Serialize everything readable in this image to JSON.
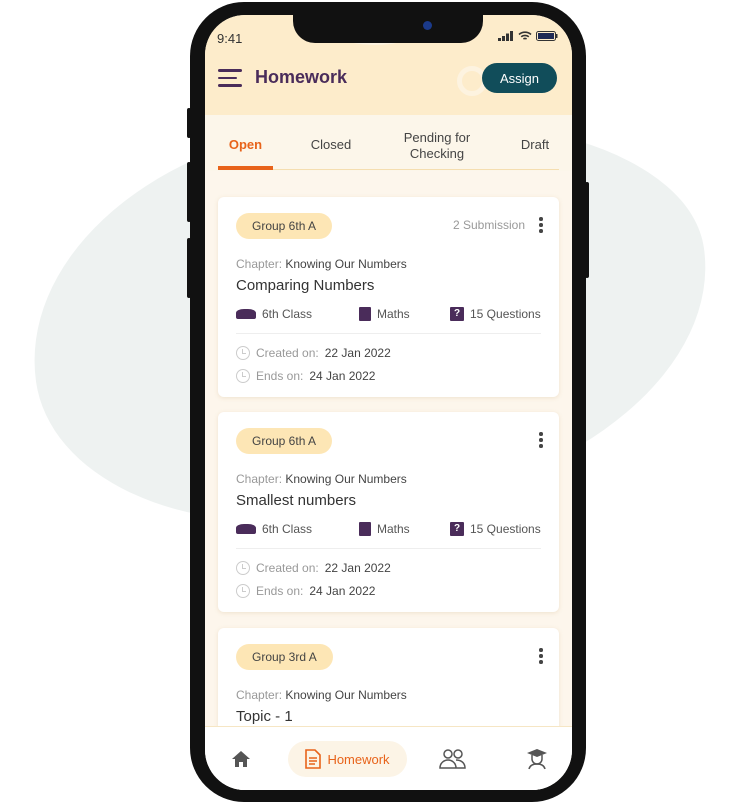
{
  "status_bar": {
    "time": "9:41"
  },
  "header": {
    "title": "Homework",
    "assign_label": "Assign"
  },
  "tabs": [
    {
      "label": "Open",
      "active": true
    },
    {
      "label": "Closed"
    },
    {
      "label": "Pending for Checking"
    },
    {
      "label": "Draft"
    }
  ],
  "cards": [
    {
      "group": "Group 6th A",
      "submissions": "2 Submission",
      "chapter_label": "Chapter:",
      "chapter": "Knowing Our Numbers",
      "title": "Comparing Numbers",
      "class": "6th Class",
      "subject": "Maths",
      "questions": "15 Questions",
      "created_label": "Created on:",
      "created": "22 Jan 2022",
      "ends_label": "Ends on:",
      "ends": "24 Jan 2022"
    },
    {
      "group": "Group 6th A",
      "chapter_label": "Chapter:",
      "chapter": "Knowing Our Numbers",
      "title": "Smallest numbers",
      "class": "6th Class",
      "subject": "Maths",
      "questions": "15 Questions",
      "created_label": "Created on:",
      "created": "22 Jan 2022",
      "ends_label": "Ends on:",
      "ends": "24 Jan 2022"
    },
    {
      "group": "Group 3rd A",
      "chapter_label": "Chapter:",
      "chapter": "Knowing Our Numbers",
      "title": "Topic - 1"
    }
  ],
  "bottom_nav": [
    {
      "icon": "home-icon"
    },
    {
      "icon": "document-icon",
      "label": "Homework",
      "active": true
    },
    {
      "icon": "users-icon"
    },
    {
      "icon": "student-icon"
    }
  ],
  "colors": {
    "accent": "#e8631a",
    "primary": "#4a2c5a",
    "button": "#114d5a",
    "header_bg": "#fdeccb",
    "chip": "#fde6b5"
  }
}
